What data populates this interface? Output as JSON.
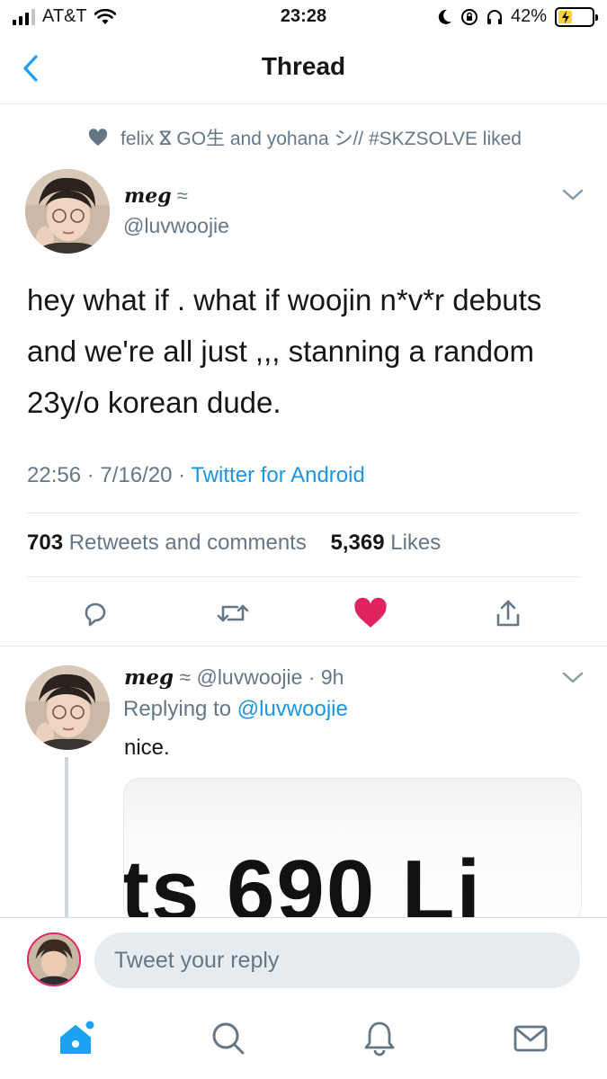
{
  "status_bar": {
    "carrier": "AT&T",
    "time": "23:28",
    "battery_percent": "42%",
    "battery_level": 0.42
  },
  "nav": {
    "title": "Thread",
    "back_icon": "chevron-left-icon"
  },
  "social_context": {
    "icon": "heart-icon",
    "text": "felix ⴵ GO生 and yohana シ// #SKZSOLVE liked"
  },
  "main_tweet": {
    "display_name": "meg",
    "name_suffix": "≈",
    "handle": "@luvwoojie",
    "text": "hey what if . what if woojin n*v*r debuts and we're all just ,,, stanning a random 23y/o korean dude.",
    "time": "22:56",
    "date": "7/16/20",
    "source": "Twitter for Android",
    "retweets_count": "703",
    "retweets_label": "Retweets and comments",
    "likes_count": "5,369",
    "likes_label": "Likes"
  },
  "actions": {
    "reply_icon": "reply-icon",
    "retweet_icon": "retweet-icon",
    "like_icon": "heart-filled-icon",
    "share_icon": "share-icon",
    "like_color": "#e0245e"
  },
  "reply_tweet": {
    "display_name": "meg",
    "name_suffix": "≈",
    "handle": "@luvwoojie",
    "time_ago": "9h",
    "replying_to_label": "Replying to",
    "replying_to_handle": "@luvwoojie",
    "text": "nice.",
    "media_text": "ts  690 Li"
  },
  "compose": {
    "placeholder": "Tweet your reply"
  },
  "tabbar": {
    "tabs": [
      "home-icon",
      "search-icon",
      "notifications-icon",
      "messages-icon"
    ],
    "accent": "#1da1f2"
  }
}
